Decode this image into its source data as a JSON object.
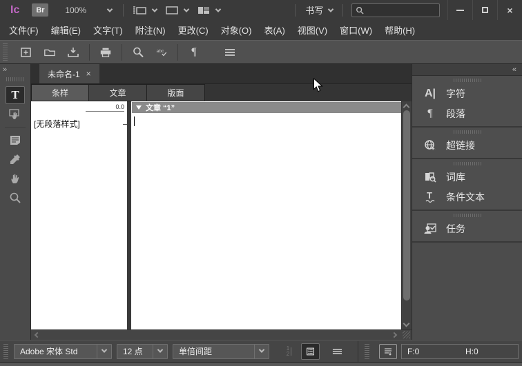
{
  "titlebar": {
    "logo": "Ic",
    "bridge_label": "Br",
    "zoom_value": "100%",
    "workspace_label": "书写",
    "search_value": ""
  },
  "menubar": {
    "items": [
      "文件(F)",
      "编辑(E)",
      "文字(T)",
      "附注(N)",
      "更改(C)",
      "对象(O)",
      "表(A)",
      "视图(V)",
      "窗口(W)",
      "帮助(H)"
    ]
  },
  "document": {
    "tab_title": "未命名-1",
    "close_glyph": "×"
  },
  "view_tabs": {
    "items": [
      {
        "label": "条样",
        "active": true
      },
      {
        "label": "文章",
        "active": false
      },
      {
        "label": "版面",
        "active": false
      }
    ]
  },
  "galley": {
    "depth_value": "0.0",
    "style_label": "[无段落样式]"
  },
  "story": {
    "header": "文章 “1”"
  },
  "sidebar": {
    "collapse_glyph": "«",
    "groups": [
      {
        "items": [
          {
            "label": "字符"
          },
          {
            "label": "段落"
          }
        ]
      },
      {
        "items": [
          {
            "label": "超链接"
          }
        ]
      },
      {
        "items": [
          {
            "label": "词库"
          },
          {
            "label": "条件文本"
          }
        ]
      },
      {
        "items": [
          {
            "label": "任务"
          }
        ]
      }
    ]
  },
  "tools_panel": {
    "expand_glyph": "»",
    "type_tool_glyph": "T"
  },
  "statusbar": {
    "font_value": "Adobe 宋体 Std",
    "size_value": "12 点",
    "leading_value": "单倍间距",
    "fit_value": "F:0",
    "height_value": "H:0"
  },
  "icons": {
    "character": "A|",
    "paragraph": "¶",
    "pilcrow_toolbar": "¶",
    "spellcheck_text": "abc",
    "conditional_text": "T"
  },
  "colors": {
    "logo_accent": "#c168c4",
    "story_header_bg": "#8a8a8a",
    "panel_bg": "#4e4e4e",
    "selected_tool_bg": "#2b2b2b"
  }
}
